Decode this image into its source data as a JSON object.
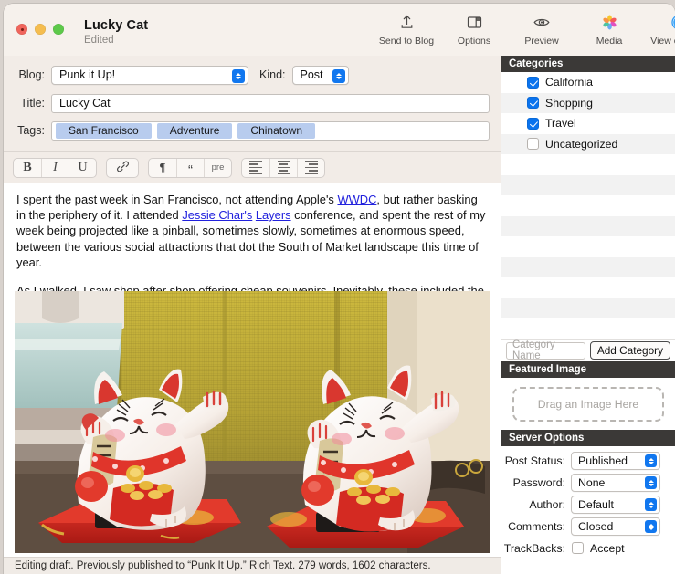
{
  "window": {
    "title": "Lucky Cat",
    "subtitle": "Edited",
    "traffic": {
      "close": "close-button",
      "minimize": "minimize-button",
      "zoom": "zoom-button"
    }
  },
  "toolbar": {
    "items": [
      {
        "label": "Send to Blog",
        "icon": "upload-icon"
      },
      {
        "label": "Options",
        "icon": "panel-icon"
      },
      {
        "label": "Preview",
        "icon": "eye-icon"
      },
      {
        "label": "Media",
        "icon": "photos-icon"
      },
      {
        "label": "View on Web",
        "icon": "safari-icon"
      }
    ]
  },
  "fields": {
    "blog_label": "Blog:",
    "blog_value": "Punk it Up!",
    "kind_label": "Kind:",
    "kind_value": "Post",
    "title_label": "Title:",
    "title_value": "Lucky Cat",
    "tags_label": "Tags:",
    "tags": [
      "San Francisco",
      "Adventure",
      "Chinatown"
    ]
  },
  "format_toolbar": {
    "bold": "B",
    "italic": "I",
    "underline": "U",
    "link": "link-icon",
    "paragraph": "¶",
    "quote": "“",
    "pre": "pre",
    "align_left": "align-left-icon",
    "align_center": "align-center-icon",
    "align_right": "align-right-icon"
  },
  "editor": {
    "p1_a": "I spent the past week in San Francisco, not attending Apple's ",
    "p1_link1": "WWDC",
    "p1_b": ", but rather basking in the periphery of it. I attended ",
    "p1_link2": "Jessie Char's",
    "p1_c": " ",
    "p1_link3": "Layers",
    "p1_d": " conference, and spent the rest of my week being projected like a pinball, sometimes slowly, sometimes at enormous speed, between the various social attractions that dot the South of Market landscape this time of year.",
    "p2": "As I walked, I saw shop after shop offering cheap souvenirs. Inevitably, these included the cheap, plastic, waving cats that are increasingly solar powered:",
    "image_alt": "Two white maneki-neko lucky cat figurines with red collars and gold coins on red solar bases, in front of a golden woven screen"
  },
  "status_bar": {
    "text": "Editing draft. Previously published to “Punk It Up.” Rich Text. 279 words, 1602 characters."
  },
  "inspector": {
    "categories": {
      "header": "Categories",
      "items": [
        {
          "label": "California",
          "checked": true
        },
        {
          "label": "Shopping",
          "checked": true
        },
        {
          "label": "Travel",
          "checked": true
        },
        {
          "label": "Uncategorized",
          "checked": false
        }
      ],
      "empty_rows": 8,
      "input_placeholder": "Category Name",
      "input_value": "",
      "add_button": "Add Category"
    },
    "featured_image": {
      "header": "Featured Image",
      "dropzone_text": "Drag an Image Here"
    },
    "server_options": {
      "header": "Server Options",
      "rows": [
        {
          "label": "Post Status:",
          "value": "Published"
        },
        {
          "label": "Password:",
          "value": "None"
        },
        {
          "label": "Author:",
          "value": "Default"
        },
        {
          "label": "Comments:",
          "value": "Closed"
        }
      ],
      "trackbacks_label": "TrackBacks:",
      "trackbacks_value": "Accept",
      "trackbacks_checked": false
    }
  },
  "colors": {
    "window_bg": "#f2ece7",
    "accent_blue": "#1177ef",
    "header_dark": "#3b3937",
    "tag_bg": "#b8ccee",
    "link": "#2222dd"
  }
}
